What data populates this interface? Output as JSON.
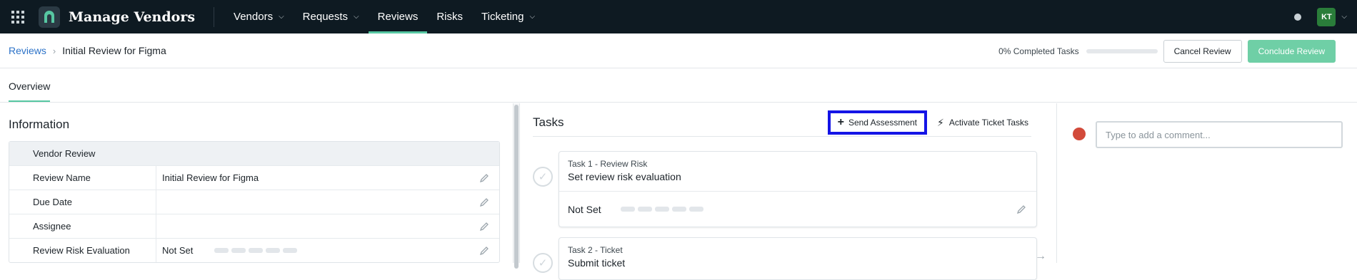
{
  "app": {
    "title": "Manage Vendors"
  },
  "nav": {
    "items": [
      {
        "label": "Vendors",
        "has_menu": true
      },
      {
        "label": "Requests",
        "has_menu": true
      },
      {
        "label": "Reviews",
        "has_menu": false,
        "active": true
      },
      {
        "label": "Risks",
        "has_menu": false
      },
      {
        "label": "Ticketing",
        "has_menu": true
      }
    ],
    "user_initials": "KT"
  },
  "breadcrumb": {
    "parent": "Reviews",
    "current": "Initial Review for Figma"
  },
  "header": {
    "progress_label": "0% Completed Tasks",
    "progress_fraction": 0,
    "cancel_label": "Cancel Review",
    "conclude_label": "Conclude Review"
  },
  "tabs": [
    {
      "label": "Overview",
      "active": true
    }
  ],
  "information": {
    "title": "Information",
    "group_label": "Vendor Review",
    "rows": [
      {
        "label": "Review Name",
        "value": "Initial Review for Figma"
      },
      {
        "label": "Due Date",
        "value": ""
      },
      {
        "label": "Assignee",
        "value": ""
      },
      {
        "label": "Review Risk Evaluation",
        "value": "Not Set"
      }
    ]
  },
  "tasks": {
    "title": "Tasks",
    "send_assessment_label": "Send Assessment",
    "activate_tickets_label": "Activate Ticket Tasks",
    "items": [
      {
        "kicker": "Task 1 - Review Risk",
        "name": "Set review risk evaluation",
        "status": "Not Set"
      },
      {
        "kicker": "Task 2 - Ticket",
        "name": "Submit ticket"
      }
    ]
  },
  "comments": {
    "placeholder": "Type to add a comment..."
  },
  "colors": {
    "accent": "#57c7a2",
    "primary_button": "#6fcfa6",
    "nav_bg": "#0e1a22",
    "link": "#2d73c8",
    "highlight_border": "#1414e6"
  }
}
